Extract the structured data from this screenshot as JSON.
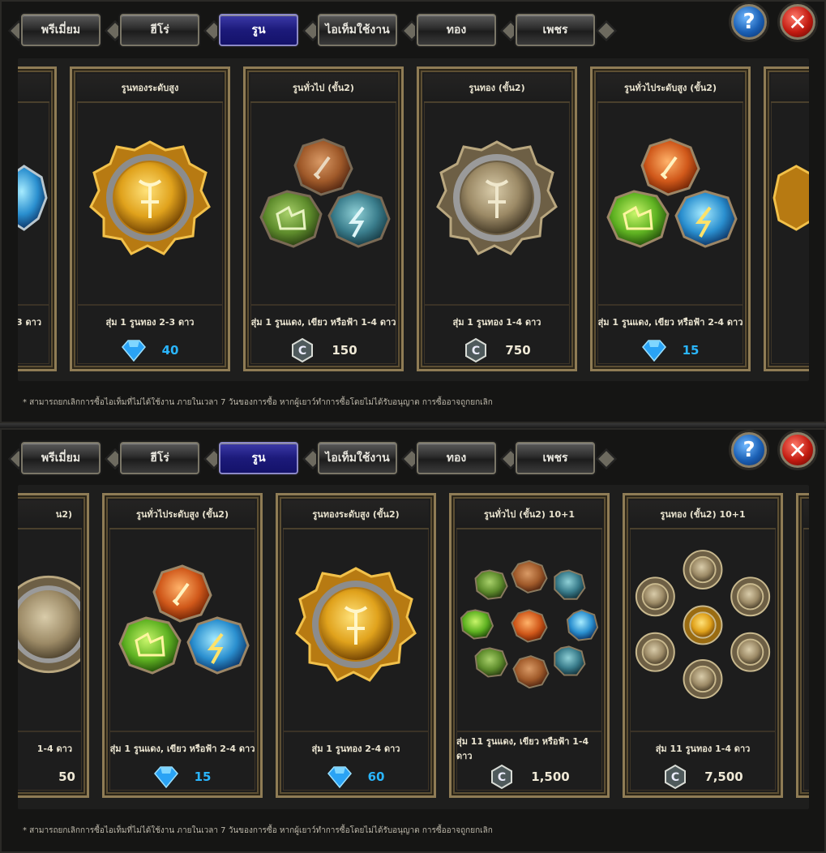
{
  "tabs": [
    {
      "label": "พรีเมี่ยม",
      "active": false
    },
    {
      "label": "ฮีโร่",
      "active": false
    },
    {
      "label": "รูน",
      "active": true
    },
    {
      "label": "ไอเท็มใช้งาน",
      "active": false
    },
    {
      "label": "ทอง",
      "active": false
    },
    {
      "label": "เพชร",
      "active": false
    }
  ],
  "help_label": "?",
  "close_label": "✕",
  "note": "* สามารถยกเลิกการซื้อไอเท็มที่ไม่ได้ใช้งาน ภายในเวลา 7 วันของการซื้อ หากผู้เยาว์ทำการซื้อโดยไม่ได้รับอนุญาต การซื้ออาจถูกยกเลิก",
  "panel1": {
    "partial_left": {
      "desc": "3 ดาว"
    },
    "cards": [
      {
        "title": "รูนทองระดับสูง",
        "desc": "สุ่ม 1 รูนทอง 2-3 ดาว",
        "currency": "gem",
        "price": "40",
        "icon": "gold-rune-icon"
      },
      {
        "title": "รูนทั่วไป (ขั้น2)",
        "desc": "สุ่ม 1 รูนแดง, เขียว หรือฟ้า 1-4 ดาว",
        "currency": "coin",
        "price": "150",
        "icon": "three-runes-icon"
      },
      {
        "title": "รูนทอง (ขั้น2)",
        "desc": "สุ่ม 1 รูนทอง 1-4 ดาว",
        "currency": "coin",
        "price": "750",
        "icon": "bronze-rune-icon"
      },
      {
        "title": "รูนทั่วไประดับสูง (ขั้น2)",
        "desc": "สุ่ม 1 รูนแดง, เขียว หรือฟ้า 2-4 ดาว",
        "currency": "gem",
        "price": "15",
        "icon": "three-runes-bright-icon"
      }
    ]
  },
  "panel2": {
    "partial_left": {
      "title": "น2)",
      "desc": "1-4 ดาว",
      "price": "50"
    },
    "cards": [
      {
        "title": "รูนทั่วไประดับสูง (ขั้น2)",
        "desc": "สุ่ม 1 รูนแดง, เขียว หรือฟ้า 2-4 ดาว",
        "currency": "gem",
        "price": "15",
        "icon": "three-runes-bright-icon"
      },
      {
        "title": "รูนทองระดับสูง (ขั้น2)",
        "desc": "สุ่ม 1 รูนทอง 2-4 ดาว",
        "currency": "gem",
        "price": "60",
        "icon": "gold-rune-icon"
      },
      {
        "title": "รูนทั่วไป (ขั้น2) 10+1",
        "desc": "สุ่ม 11 รูนแดง, เขียว หรือฟ้า 1-4 ดาว",
        "currency": "coin",
        "price": "1,500",
        "icon": "rune-cluster-icon"
      },
      {
        "title": "รูนทอง (ขั้น2) 10+1",
        "desc": "สุ่ม 11 รูนทอง 1-4 ดาว",
        "currency": "coin",
        "price": "7,500",
        "icon": "gold-rune-cluster-icon"
      }
    ]
  }
}
